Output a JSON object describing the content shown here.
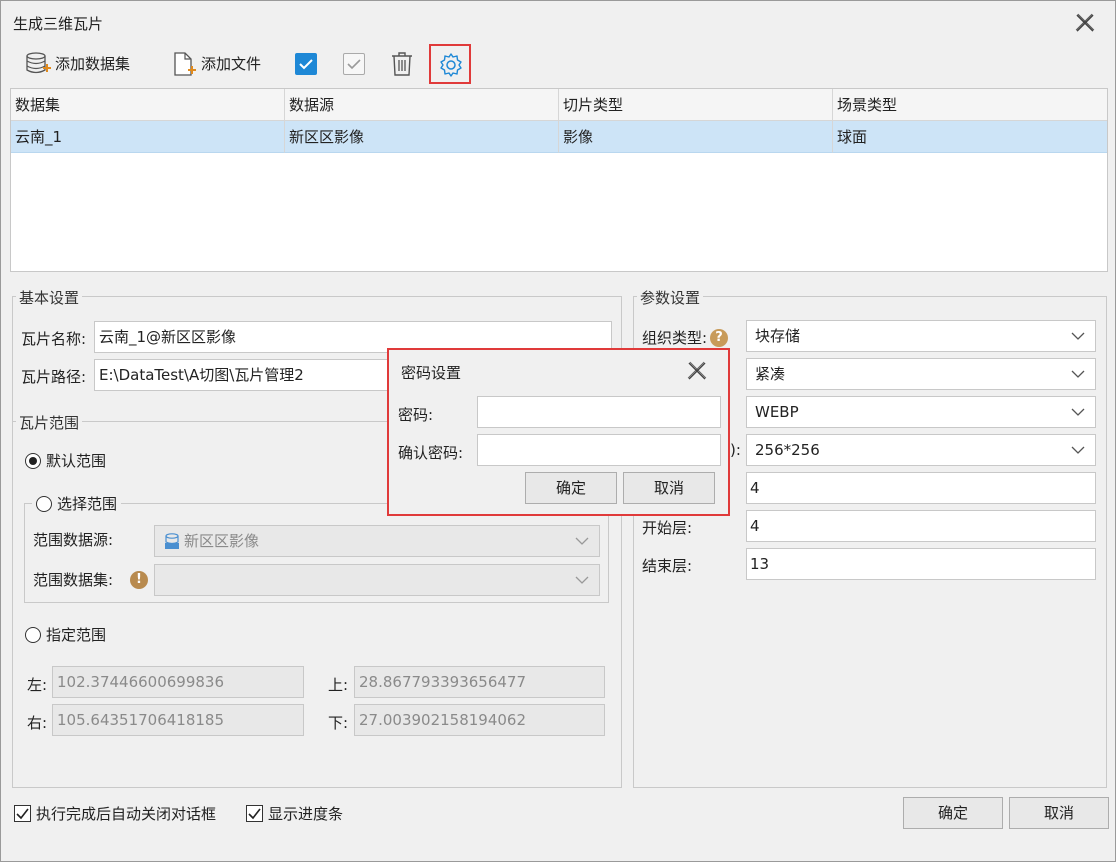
{
  "window": {
    "title": "生成三维瓦片"
  },
  "toolbar": {
    "add_dataset": "添加数据集",
    "add_file": "添加文件",
    "icons": [
      "database-add-icon",
      "file-add-icon",
      "select-all-icon",
      "invert-select-icon",
      "delete-icon",
      "settings-icon"
    ]
  },
  "grid": {
    "headers": [
      "数据集",
      "数据源",
      "切片类型",
      "场景类型"
    ],
    "rows": [
      [
        "云南_1",
        "新区区影像",
        "影像",
        "球面"
      ]
    ]
  },
  "basic": {
    "group_label": "基本设置",
    "name_label": "瓦片名称:",
    "name_value": "云南_1@新区区影像",
    "path_label": "瓦片路径:",
    "path_value": "E:\\DataTest\\A切图\\瓦片管理2"
  },
  "range": {
    "group_label": "瓦片范围",
    "default_label": "默认范围",
    "select_label": "选择范围",
    "source_label": "范围数据源:",
    "source_value": "新区区影像",
    "dataset_label": "范围数据集:",
    "dataset_value": "",
    "specify_label": "指定范围",
    "left_label": "左:",
    "left_value": "102.37446600699836",
    "top_label": "上:",
    "top_value": "28.867793393656477",
    "right_label": "右:",
    "right_value": "105.64351706418185",
    "bottom_label": "下:",
    "bottom_value": "27.003902158194062"
  },
  "params": {
    "group_label": "参数设置",
    "org_type_label": "组织类型:",
    "org_type_value": "块存储",
    "row2_value": "紧凑",
    "row3_value": "WEBP",
    "row4_label_tail": "):",
    "row4_value": "256*256",
    "row5_value": "4",
    "start_label": "开始层:",
    "start_value": "4",
    "end_label": "结束层:",
    "end_value": "13"
  },
  "footer": {
    "auto_close_label": "执行完成后自动关闭对话框",
    "show_progress_label": "显示进度条",
    "ok_label": "确定",
    "cancel_label": "取消"
  },
  "password_dialog": {
    "title": "密码设置",
    "password_label": "密码:",
    "confirm_label": "确认密码:",
    "ok_label": "确定",
    "cancel_label": "取消"
  }
}
